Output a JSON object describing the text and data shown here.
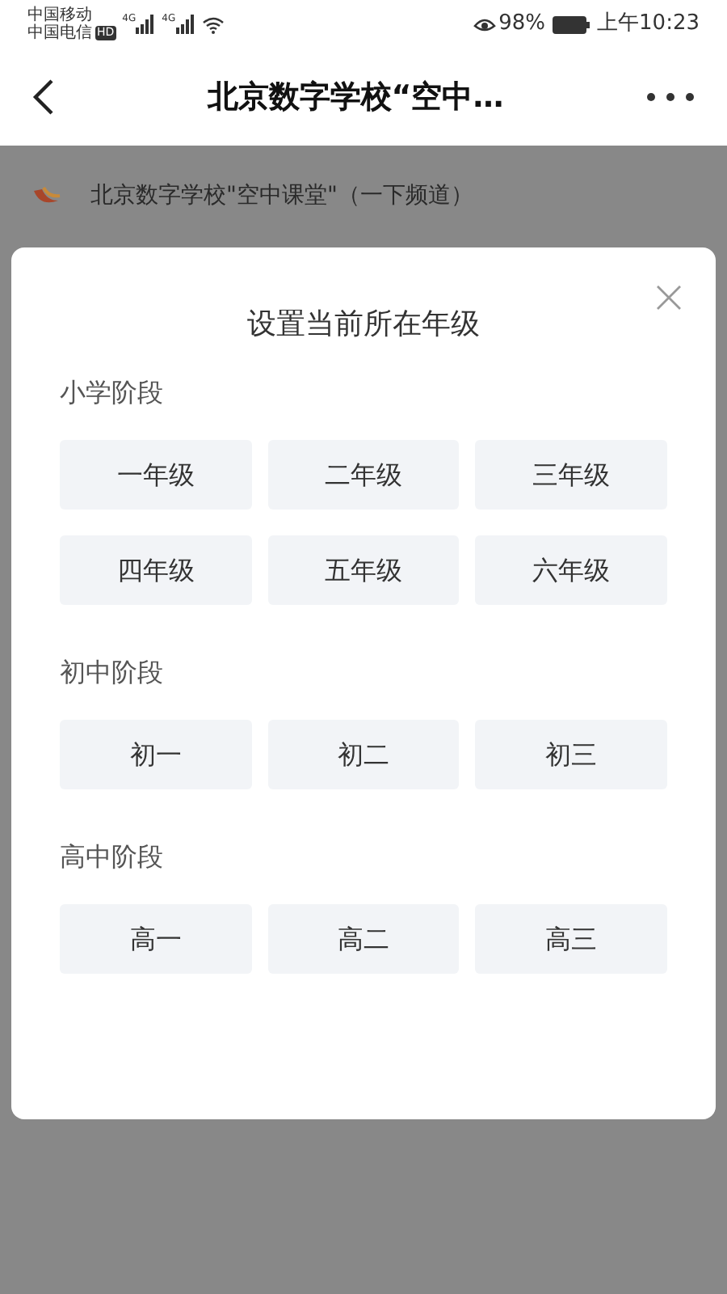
{
  "status_bar": {
    "carriers": [
      "中国移动",
      "中国电信"
    ],
    "hd": "HD",
    "networks": [
      "4G",
      "4G"
    ],
    "battery": "98%",
    "time": "上午10:23"
  },
  "nav": {
    "title": "北京数字学校“空中…"
  },
  "channel": {
    "name": "北京数字学校\"空中课堂\"（一下频道）"
  },
  "dialog": {
    "title": "设置当前所在年级",
    "sections": [
      {
        "label": "小学阶段",
        "grades": [
          "一年级",
          "二年级",
          "三年级",
          "四年级",
          "五年级",
          "六年级"
        ]
      },
      {
        "label": "初中阶段",
        "grades": [
          "初一",
          "初二",
          "初三"
        ]
      },
      {
        "label": "高中阶段",
        "grades": [
          "高一",
          "高二",
          "高三"
        ]
      }
    ]
  }
}
